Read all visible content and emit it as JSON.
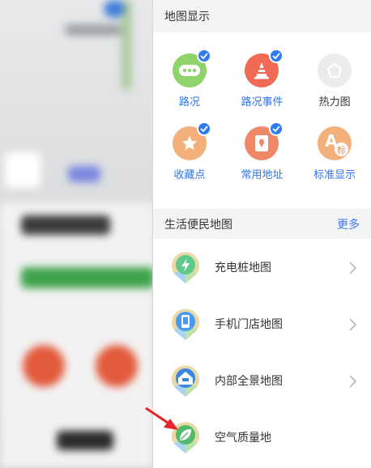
{
  "colors": {
    "accent": "#2f7bf2",
    "traffic": "#8fd46a",
    "event": "#f06a55",
    "heat": "#d6d6d6",
    "favorite": "#f4b07a",
    "address": "#f08868",
    "standard": "#f4b07a"
  },
  "map_display": {
    "title": "地图显示",
    "items": [
      {
        "label": "路况",
        "icon": "traffic-icon",
        "checked": true
      },
      {
        "label": "路况事件",
        "icon": "traffic-cone-icon",
        "checked": true
      },
      {
        "label": "热力图",
        "icon": "heatmap-pentagon-icon",
        "checked": false
      },
      {
        "label": "收藏点",
        "icon": "star-icon",
        "checked": true
      },
      {
        "label": "常用地址",
        "icon": "address-book-icon",
        "checked": true
      },
      {
        "label": "标准显示",
        "icon": "standard-display-icon",
        "checked": false,
        "icon_text": "标"
      }
    ]
  },
  "life_maps": {
    "title": "生活便民地图",
    "more": "更多",
    "items": [
      {
        "label": "充电桩地图",
        "icon": "charging-bolt-icon"
      },
      {
        "label": "手机门店地图",
        "icon": "phone-icon"
      },
      {
        "label": "内部全景地图",
        "icon": "panorama-house-icon"
      },
      {
        "label": "空气质量地",
        "icon": "leaf-icon"
      }
    ]
  }
}
